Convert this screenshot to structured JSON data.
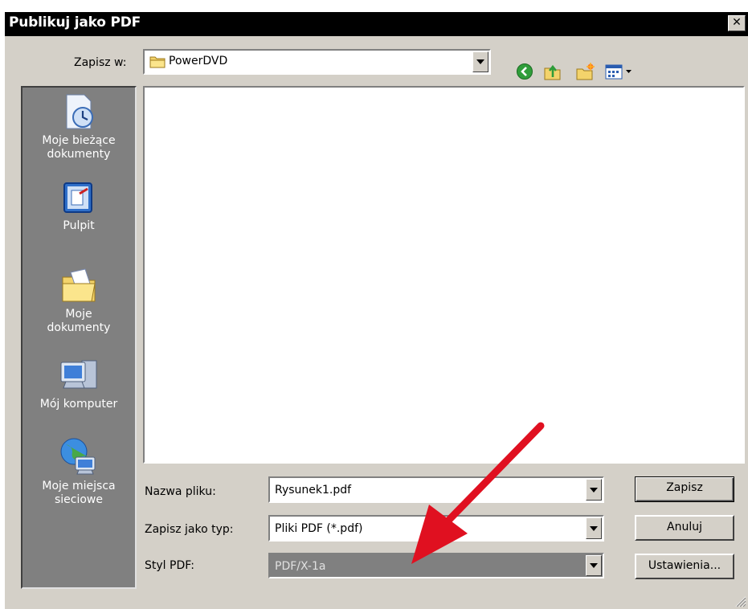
{
  "window": {
    "title": "Publikuj jako PDF"
  },
  "lookin": {
    "label": "Zapisz w:",
    "value": "PowerDVD"
  },
  "places": [
    {
      "label": "Moje bieżące dokumenty",
      "line1": "Moje bieżące",
      "line2": "dokumenty",
      "icon": "recent-documents-icon"
    },
    {
      "label": "Pulpit",
      "line1": "Pulpit",
      "line2": "",
      "icon": "desktop-icon"
    },
    {
      "label": "Moje dokumenty",
      "line1": "Moje",
      "line2": "dokumenty",
      "icon": "my-documents-icon"
    },
    {
      "label": "Mój komputer",
      "line1": "Mój komputer",
      "line2": "",
      "icon": "my-computer-icon"
    },
    {
      "label": "Moje miejsca sieciowe",
      "line1": "Moje miejsca",
      "line2": "sieciowe",
      "icon": "network-places-icon"
    }
  ],
  "fields": {
    "filename": {
      "label": "Nazwa pliku:",
      "value": "Rysunek1.pdf"
    },
    "filetype": {
      "label": "Zapisz jako typ:",
      "value": "Pliki PDF (*.pdf)"
    },
    "pdfstyle": {
      "label": "Styl PDF:",
      "value": "PDF/X-1a"
    }
  },
  "buttons": {
    "save": "Zapisz",
    "cancel": "Anuluj",
    "settings": "Ustawienia..."
  },
  "colors": {
    "titlebar": "#000000",
    "dialog": "#d4d0c8",
    "places_bar": "#808080",
    "annotation_arrow": "#e01020"
  }
}
